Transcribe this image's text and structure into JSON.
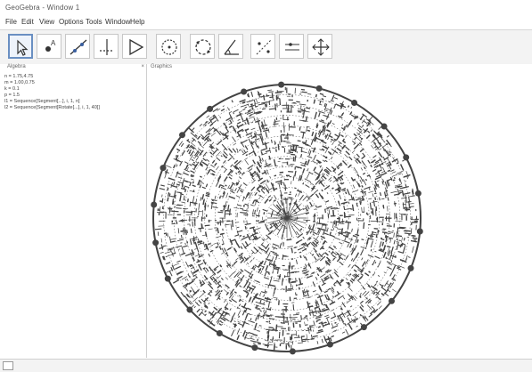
{
  "window": {
    "title": "GeoGebra - Window 1"
  },
  "menu": {
    "items": [
      "File",
      "Edit",
      "View",
      "Options",
      "Tools",
      "Window",
      "Help"
    ]
  },
  "toolbar": {
    "tools": [
      {
        "name": "move-tool",
        "icon": "arrow-icon",
        "active": true
      },
      {
        "name": "point-tool",
        "icon": "point-icon",
        "active": false
      },
      {
        "name": "line-tool",
        "icon": "line-icon",
        "active": false
      },
      {
        "name": "perpendicular-tool",
        "icon": "perpendicular-icon",
        "active": false
      },
      {
        "name": "polygon-tool",
        "icon": "polygon-icon",
        "active": false
      },
      {
        "name": "circle-tool",
        "icon": "circle-icon",
        "active": false
      },
      {
        "name": "circle-three-points-tool",
        "icon": "circle-dashed-icon",
        "active": false
      },
      {
        "name": "angle-tool",
        "icon": "angle-icon",
        "active": false
      },
      {
        "name": "reflect-tool",
        "icon": "reflect-icon",
        "active": false
      },
      {
        "name": "slider-tool",
        "icon": "slider-icon",
        "active": false
      },
      {
        "name": "move-graphics-tool",
        "icon": "move-view-icon",
        "active": false
      }
    ]
  },
  "algebra": {
    "header": "Algebra",
    "lines": [
      "n = 1.75,4.75",
      "m = 1.00,0.75",
      "k = 0.1",
      "p = 1.5",
      "l1 = Sequence[Segment[...], i, 1, n]",
      "l2 = Sequence[Segment[Rotate[...], i, 1, 40]]"
    ]
  },
  "graphics": {
    "header": "Graphics"
  },
  "colors": {
    "figure": "#444444",
    "toolbar_bg": "#f3f3f3",
    "active_tool_border": "#6a8fc2"
  }
}
